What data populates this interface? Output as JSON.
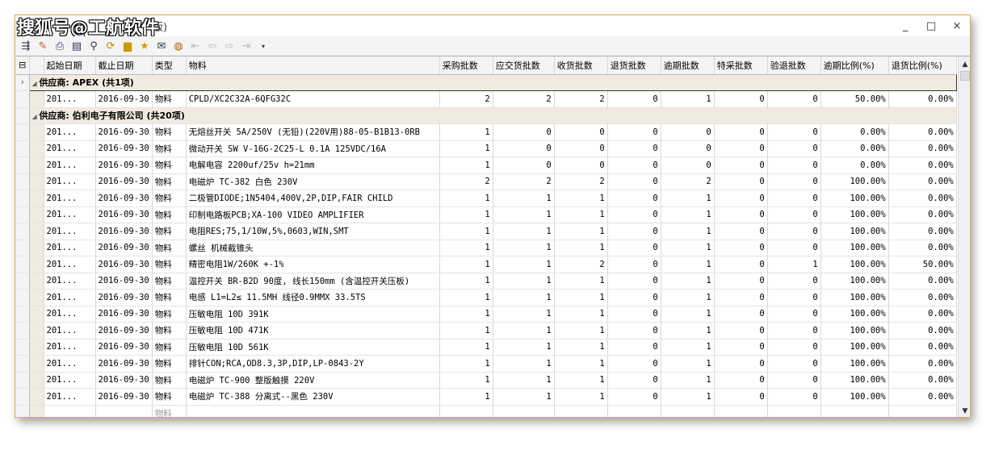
{
  "watermark": "搜狐号@工航软件",
  "window": {
    "title_partial": "版)",
    "controls": {
      "minimize": "_",
      "maximize": "□",
      "close": "×"
    }
  },
  "toolbar": {
    "icons": [
      "export-icon",
      "import-icon",
      "print-icon",
      "preview-icon",
      "find-icon",
      "refresh-icon",
      "save-icon",
      "favorite-icon",
      "mail-icon",
      "comment-icon",
      "first-icon",
      "prev-icon",
      "next-icon",
      "last-icon",
      "dropdown-icon"
    ]
  },
  "grid": {
    "collapse_symbol": "⊟",
    "columns": [
      "起始日期",
      "截止日期",
      "类型",
      "物料",
      "采购批数",
      "应交货批数",
      "收货批数",
      "退货批数",
      "逾期批数",
      "特采批数",
      "验退批数",
      "逾期比例(%)",
      "退货比例(%)"
    ],
    "groups": [
      {
        "label": "供应商: APEX (共1项)",
        "rows": [
          [
            "201...",
            "2016-09-30",
            "物料",
            "CPLD/XC2C32A-6QFG32C",
            "2",
            "2",
            "2",
            "0",
            "1",
            "0",
            "0",
            "50.00%",
            "0.00%"
          ]
        ]
      },
      {
        "label": "供应商: 伯利电子有限公司 (共20项)",
        "rows": [
          [
            "201...",
            "2016-09-30",
            "物料",
            "无熔丝开关 5A/250V (无铅)(220V用)88-05-B1B13-0RB",
            "1",
            "0",
            "0",
            "0",
            "0",
            "0",
            "0",
            "0.00%",
            "0.00%"
          ],
          [
            "201...",
            "2016-09-30",
            "物料",
            "微动开关 SW V-16G-2C25-L 0.1A 125VDC/16A",
            "1",
            "0",
            "0",
            "0",
            "0",
            "0",
            "0",
            "0.00%",
            "0.00%"
          ],
          [
            "201...",
            "2016-09-30",
            "物料",
            "电解电容 2200uf/25v h=21mm",
            "1",
            "0",
            "0",
            "0",
            "0",
            "0",
            "0",
            "0.00%",
            "0.00%"
          ],
          [
            "201...",
            "2016-09-30",
            "物料",
            "电磁炉 TC-382 白色 230V",
            "2",
            "2",
            "2",
            "0",
            "2",
            "0",
            "0",
            "100.00%",
            "0.00%"
          ],
          [
            "201...",
            "2016-09-30",
            "物料",
            "二极管DIODE;1N5404,400V,2P,DIP,FAIR CHILD",
            "1",
            "1",
            "1",
            "0",
            "1",
            "0",
            "0",
            "100.00%",
            "0.00%"
          ],
          [
            "201...",
            "2016-09-30",
            "物料",
            "印制电路板PCB;XA-100 VIDEO AMPLIFIER",
            "1",
            "1",
            "1",
            "0",
            "1",
            "0",
            "0",
            "100.00%",
            "0.00%"
          ],
          [
            "201...",
            "2016-09-30",
            "物料",
            "电阻RES;75,1/10W,5%,0603,WIN,SMT",
            "1",
            "1",
            "1",
            "0",
            "1",
            "0",
            "0",
            "100.00%",
            "0.00%"
          ],
          [
            "201...",
            "2016-09-30",
            "物料",
            "螺丝 机械截锥头",
            "1",
            "1",
            "1",
            "0",
            "1",
            "0",
            "0",
            "100.00%",
            "0.00%"
          ],
          [
            "201...",
            "2016-09-30",
            "物料",
            "精密电阻1W/260K +-1%",
            "1",
            "1",
            "2",
            "0",
            "1",
            "0",
            "1",
            "100.00%",
            "50.00%"
          ],
          [
            "201...",
            "2016-09-30",
            "物料",
            "温控开关 BR-B2D 90度, 线长150mm (含温控开关压板)",
            "1",
            "1",
            "1",
            "0",
            "1",
            "0",
            "0",
            "100.00%",
            "0.00%"
          ],
          [
            "201...",
            "2016-09-30",
            "物料",
            "电感 L1=L2≤ 11.5MH 线径0.9MMX 33.5TS",
            "1",
            "1",
            "1",
            "0",
            "1",
            "0",
            "0",
            "100.00%",
            "0.00%"
          ],
          [
            "201...",
            "2016-09-30",
            "物料",
            "压敏电阻 10D 391K",
            "1",
            "1",
            "1",
            "0",
            "1",
            "0",
            "0",
            "100.00%",
            "0.00%"
          ],
          [
            "201...",
            "2016-09-30",
            "物料",
            "压敏电阻 10D 471K",
            "1",
            "1",
            "1",
            "0",
            "1",
            "0",
            "0",
            "100.00%",
            "0.00%"
          ],
          [
            "201...",
            "2016-09-30",
            "物料",
            "压敏电阻 10D 561K",
            "1",
            "1",
            "1",
            "0",
            "1",
            "0",
            "0",
            "100.00%",
            "0.00%"
          ],
          [
            "201...",
            "2016-09-30",
            "物料",
            "排针CON;RCA,OD8.3,3P,DIP,LP-0843-2Y",
            "1",
            "1",
            "1",
            "0",
            "1",
            "0",
            "0",
            "100.00%",
            "0.00%"
          ],
          [
            "201...",
            "2016-09-30",
            "物料",
            "电磁炉 TC-900 整版触摸 220V",
            "1",
            "1",
            "1",
            "0",
            "1",
            "0",
            "0",
            "100.00%",
            "0.00%"
          ],
          [
            "201...",
            "2016-09-30",
            "物料",
            "电磁炉 TC-388 分离式--黑色 230V",
            "1",
            "1",
            "1",
            "0",
            "1",
            "0",
            "0",
            "100.00%",
            "0.00%"
          ]
        ]
      }
    ],
    "partial_row": [
      "",
      "",
      "物料",
      "",
      "",
      "",
      "",
      "",
      "",
      "",
      "",
      "",
      ""
    ]
  }
}
